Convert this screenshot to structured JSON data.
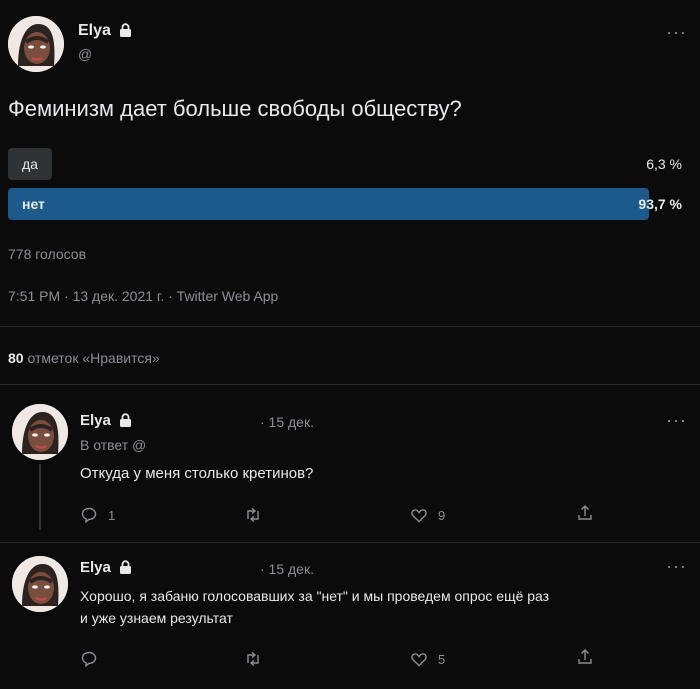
{
  "post": {
    "author": "Elya",
    "handle": "@",
    "question": "Феминизм дает больше свободы обществу?",
    "options": [
      {
        "label": "да",
        "pct_text": "6,3 %",
        "share": 0.063
      },
      {
        "label": "нет",
        "pct_text": "93,7 %",
        "share": 0.937
      }
    ],
    "votes": "778 голосов",
    "meta": "7:51 PM · 13 дек. 2021 г. · Twitter Web App",
    "likes_count": "80",
    "likes_label": "отметок «Нравится»"
  },
  "replies": [
    {
      "author": "Elya",
      "date": "· 15 дек.",
      "reply_to": "В ответ @",
      "text": "Откуда у меня столько кретинов?",
      "reply_count": "1",
      "retweet_count": "",
      "like_count": "9"
    },
    {
      "author": "Elya",
      "date": "· 15 дек.",
      "text_line1": "Хорошо, я забаню голосовавших за \"нет\" и мы проведем опрос ещё раз",
      "text_line2": "и уже узнаем результат",
      "reply_count": "",
      "retweet_count": "",
      "like_count": "5"
    }
  ],
  "colors": {
    "bar_low": "#2f3336",
    "bar_high": "#1d5a8c"
  },
  "icons": [
    "avatar",
    "lock-icon",
    "more-icon",
    "reply-icon",
    "retweet-icon",
    "like-icon",
    "share-icon"
  ]
}
